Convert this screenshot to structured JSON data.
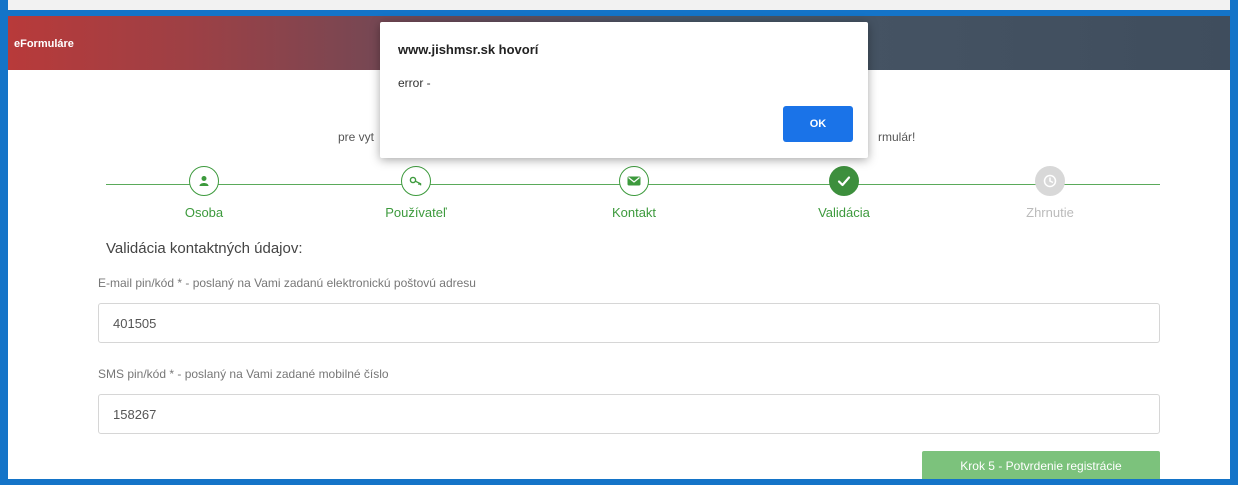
{
  "navbar": {
    "brand": "eFormuláre"
  },
  "subtitle": {
    "left": "pre vyt",
    "right": "rmulár!"
  },
  "steps": [
    {
      "label": "Osoba",
      "icon": "person-icon",
      "state": "active"
    },
    {
      "label": "Používateľ",
      "icon": "key-icon",
      "state": "active"
    },
    {
      "label": "Kontakt",
      "icon": "envelope-icon",
      "state": "active"
    },
    {
      "label": "Validácia",
      "icon": "checkmark-icon",
      "state": "done"
    },
    {
      "label": "Zhrnutie",
      "icon": "clock-icon",
      "state": "disabled"
    }
  ],
  "form": {
    "section_title": "Validácia kontaktných údajov:",
    "email_label": "E-mail pin/kód * - poslaný na Vami zadanú elektronickú poštovú adresu",
    "email_value": "401505",
    "sms_label": "SMS pin/kód * - poslaný na Vami zadané mobilné číslo",
    "sms_value": "158267",
    "submit_label": "Krok 5 - Potvrdenie registrácie"
  },
  "dialog": {
    "title": "www.jishmsr.sk hovorí",
    "message": "error -",
    "ok_label": "OK"
  },
  "colors": {
    "frame": "#1474c8",
    "step_green": "#3d9a3d",
    "submit_green": "#7cc27c",
    "dialog_button": "#1a73e8"
  }
}
